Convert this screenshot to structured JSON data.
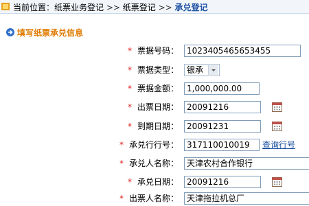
{
  "breadcrumb": {
    "prefix": "当前位置：纸票业务登记",
    "sep1": " >> ",
    "item2": "纸票登记",
    "sep2": " >> ",
    "current": "承兑登记"
  },
  "section": {
    "title": "填写纸票承兑信息"
  },
  "form": {
    "required_mark": "*",
    "fields": [
      {
        "label": "票据号码：",
        "value": "1023405465653455"
      },
      {
        "label": "票据类型：",
        "value": "银承"
      },
      {
        "label": "票据金额：",
        "value": "1,000,000.00"
      },
      {
        "label": "出票日期：",
        "value": "20091216"
      },
      {
        "label": "到期日期：",
        "value": "20091231"
      },
      {
        "label": "承兑行行号：",
        "value": "317110010019",
        "link": "查询行号"
      },
      {
        "label": "承兑人名称：",
        "value": "天津农村合作银行"
      },
      {
        "label": "承兑日期：",
        "value": "20091216"
      },
      {
        "label": "出票人名称：",
        "value": "天津拖拉机总厂"
      }
    ]
  },
  "colors": {
    "accent": "#1a4fa0",
    "section": "#e07a00",
    "required": "#e02020"
  },
  "icons": {
    "home": "home-icon",
    "arrow": "arrow-right-icon",
    "calendar": "calendar-icon",
    "dropdown": "chevron-down-icon"
  }
}
